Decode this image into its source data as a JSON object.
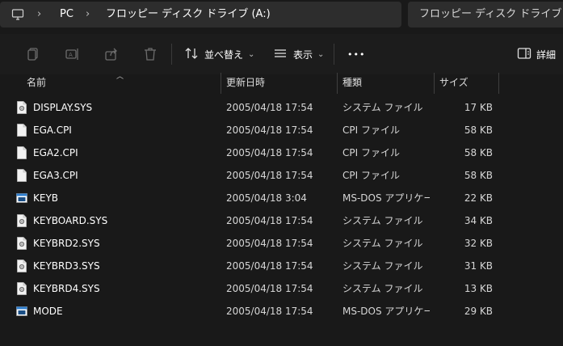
{
  "address": {
    "crumbs": [
      "PC",
      "フロッピー ディスク ドライブ (A:)"
    ]
  },
  "search": {
    "placeholder": "フロッピー ディスク ドライブ"
  },
  "toolbar": {
    "sort_label": "並べ替え",
    "view_label": "表示",
    "details_label": "詳細",
    "more_label": "•••"
  },
  "columns": {
    "name": "名前",
    "date": "更新日時",
    "type": "種類",
    "size": "サイズ"
  },
  "files": [
    {
      "name": "DISPLAY.SYS",
      "date": "2005/04/18 17:54",
      "type": "システム ファイル",
      "size": "17 KB",
      "icon": "system-file-icon"
    },
    {
      "name": "EGA.CPI",
      "date": "2005/04/18 17:54",
      "type": "CPI ファイル",
      "size": "58 KB",
      "icon": "file-icon"
    },
    {
      "name": "EGA2.CPI",
      "date": "2005/04/18 17:54",
      "type": "CPI ファイル",
      "size": "58 KB",
      "icon": "file-icon"
    },
    {
      "name": "EGA3.CPI",
      "date": "2005/04/18 17:54",
      "type": "CPI ファイル",
      "size": "58 KB",
      "icon": "file-icon"
    },
    {
      "name": "KEYB",
      "date": "2005/04/18 3:04",
      "type": "MS-DOS アプリケー...",
      "size": "22 KB",
      "icon": "application-icon"
    },
    {
      "name": "KEYBOARD.SYS",
      "date": "2005/04/18 17:54",
      "type": "システム ファイル",
      "size": "34 KB",
      "icon": "system-file-icon"
    },
    {
      "name": "KEYBRD2.SYS",
      "date": "2005/04/18 17:54",
      "type": "システム ファイル",
      "size": "32 KB",
      "icon": "system-file-icon"
    },
    {
      "name": "KEYBRD3.SYS",
      "date": "2005/04/18 17:54",
      "type": "システム ファイル",
      "size": "31 KB",
      "icon": "system-file-icon"
    },
    {
      "name": "KEYBRD4.SYS",
      "date": "2005/04/18 17:54",
      "type": "システム ファイル",
      "size": "13 KB",
      "icon": "system-file-icon"
    },
    {
      "name": "MODE",
      "date": "2005/04/18 17:54",
      "type": "MS-DOS アプリケー...",
      "size": "29 KB",
      "icon": "application-icon"
    }
  ]
}
